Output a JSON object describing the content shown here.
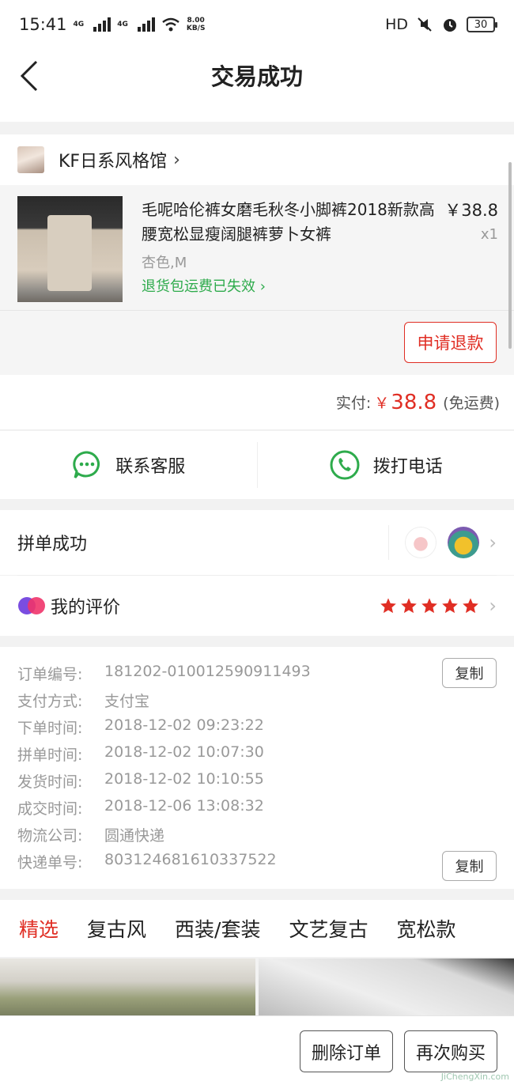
{
  "status_bar": {
    "time": "15:41",
    "network_1": "4G",
    "network_2": "4G",
    "speed_value": "8.00",
    "speed_unit": "KB/S",
    "hd": "HD",
    "battery": "30"
  },
  "header": {
    "title": "交易成功"
  },
  "shop": {
    "name": "KF日系风格馆"
  },
  "product": {
    "title": "毛呢哈伦裤女磨毛秋冬小脚裤2018新款高腰宽松显瘦阔腿裤萝卜女裤",
    "price": "￥38.8",
    "quantity": "x1",
    "spec": "杏色,M",
    "return_note": "退货包运费已失效",
    "refund_label": "申请退款"
  },
  "payment": {
    "label": "实付:",
    "currency": "￥",
    "amount": "38.8",
    "note": "(免运费)"
  },
  "contact": {
    "service_label": "联系客服",
    "phone_label": "拨打电话"
  },
  "group": {
    "label": "拼单成功"
  },
  "rating": {
    "label": "我的评价",
    "stars": 5
  },
  "order_info": {
    "copy_label": "复制",
    "rows": [
      {
        "key": "订单编号:",
        "value": "181202-010012590911493"
      },
      {
        "key": "支付方式:",
        "value": "支付宝"
      },
      {
        "key": "下单时间:",
        "value": "2018-12-02 09:23:22"
      },
      {
        "key": "拼单时间:",
        "value": "2018-12-02 10:07:30"
      },
      {
        "key": "发货时间:",
        "value": "2018-12-02 10:10:55"
      },
      {
        "key": "成交时间:",
        "value": "2018-12-06 13:08:32"
      },
      {
        "key": "物流公司:",
        "value": "圆通快递"
      },
      {
        "key": "快递单号:",
        "value": "803124681610337522"
      }
    ]
  },
  "tabs": [
    "精选",
    "复古风",
    "西装/套装",
    "文艺复古",
    "宽松款"
  ],
  "bottom": {
    "delete_label": "删除订单",
    "rebuy_label": "再次购买"
  },
  "watermark": "JiChengXin.com",
  "colors": {
    "accent": "#e02e24",
    "green": "#2eab4c",
    "star": "#e02e24"
  }
}
